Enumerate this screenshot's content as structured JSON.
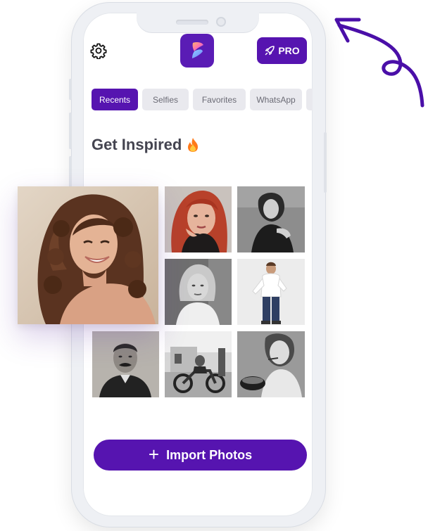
{
  "header": {
    "pro_label": "PRO"
  },
  "tabs": [
    {
      "label": "Recents",
      "active": true
    },
    {
      "label": "Selfies",
      "active": false
    },
    {
      "label": "Favorites",
      "active": false
    },
    {
      "label": "WhatsApp",
      "active": false
    },
    {
      "label": "",
      "active": false
    }
  ],
  "section": {
    "title": "Get Inspired",
    "title_icon": "fire-icon"
  },
  "photos": [
    {
      "name": "featured-photo-smiling-woman",
      "style": "color"
    },
    {
      "name": "photo-redhead-woman",
      "style": "color"
    },
    {
      "name": "photo-woman-bw",
      "style": "bw"
    },
    {
      "name": "photo-blonde-woman-bw",
      "style": "bw"
    },
    {
      "name": "photo-man-white-shirt",
      "style": "color"
    },
    {
      "name": "photo-old-man-portrait",
      "style": "sepia-bw"
    },
    {
      "name": "photo-motorcycle-vintage",
      "style": "bw"
    },
    {
      "name": "photo-child-eating",
      "style": "bw"
    }
  ],
  "actions": {
    "import_label": "Import Photos",
    "import_icon": "plus-icon"
  },
  "colors": {
    "brand": "#5614b0",
    "tab_inactive": "#e9e9ee",
    "title": "#444450",
    "arrow": "#4a0fa8"
  }
}
